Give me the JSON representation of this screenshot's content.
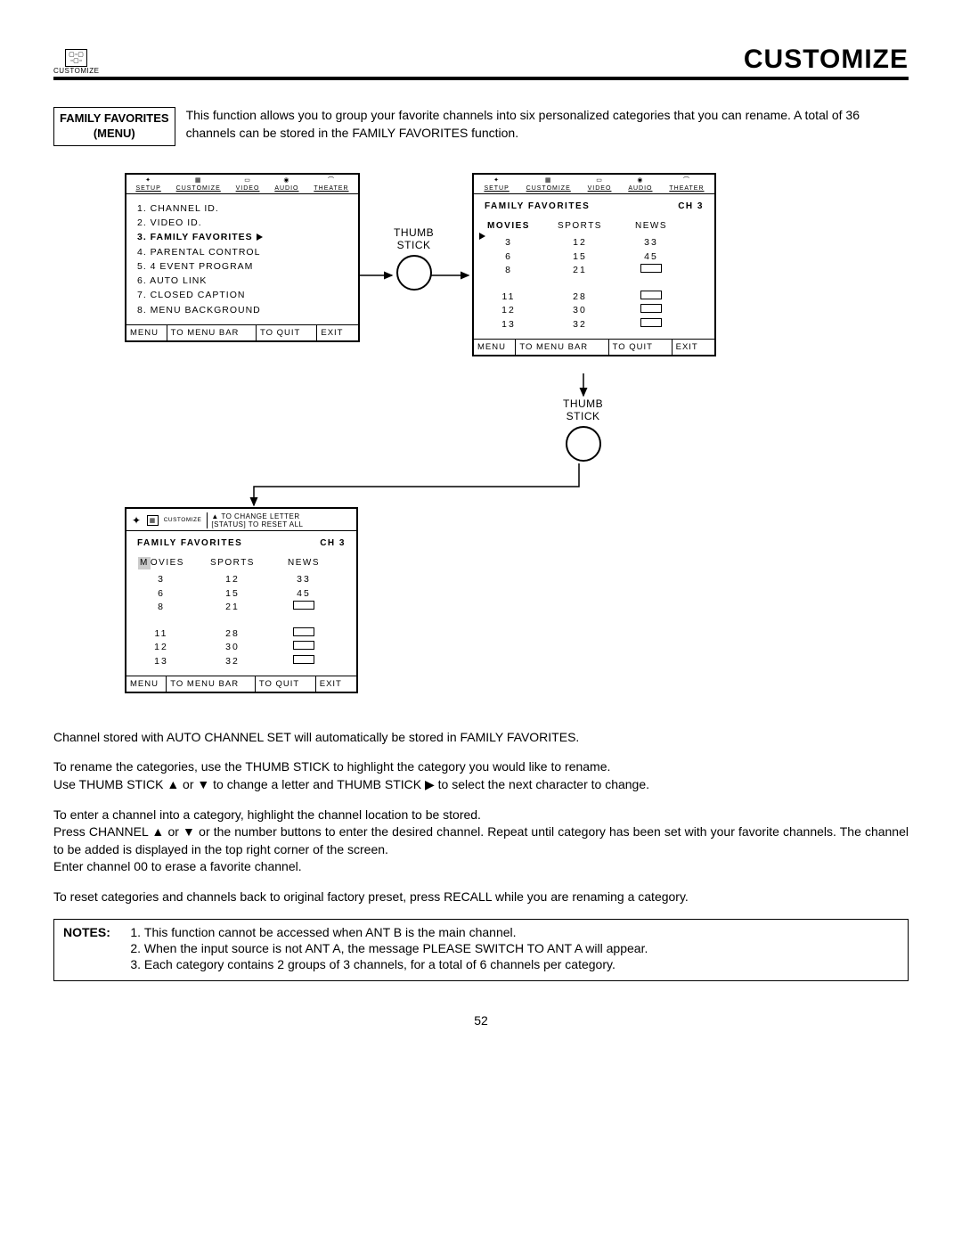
{
  "header": {
    "icon_label": "CUSTOMIZE",
    "title": "CUSTOMIZE"
  },
  "intro": {
    "box_line1": "FAMILY FAVORITES",
    "box_line2": "(MENU)",
    "text": "This function allows you to group your favorite channels into six personalized categories that you can rename. A total of 36 channels can be stored in the FAMILY FAVORITES function."
  },
  "tabs": [
    "SETUP",
    "CUSTOMIZE",
    "VIDEO",
    "AUDIO",
    "THEATER"
  ],
  "panel1": {
    "items": [
      "1. CHANNEL ID.",
      "2. VIDEO ID.",
      "3. FAMILY FAVORITES",
      "4. PARENTAL CONTROL",
      "5. 4 EVENT PROGRAM",
      "6. AUTO LINK",
      "7. CLOSED CAPTION",
      "8. MENU BACKGROUND"
    ]
  },
  "panel_footer": {
    "a": "MENU",
    "b": "TO MENU BAR",
    "c": "TO QUIT",
    "d": "EXIT"
  },
  "thumb_label": "THUMB\nSTICK",
  "ff": {
    "title": "FAMILY FAVORITES",
    "ch": "CH   3",
    "cats": [
      "MOVIES",
      "SPORTS",
      "NEWS"
    ],
    "col1": [
      "3",
      "6",
      "8",
      "",
      "11",
      "12",
      "13"
    ],
    "col2": [
      "12",
      "15",
      "21",
      "",
      "28",
      "30",
      "32"
    ],
    "col3": [
      "33",
      "45",
      "□",
      "",
      "□",
      "□",
      "□"
    ]
  },
  "panel3_head": {
    "l1": "▲ TO CHANGE LETTER",
    "l2": "[STATUS] TO RESET ALL"
  },
  "body": {
    "p1": "Channel stored with AUTO CHANNEL SET will automatically be stored in FAMILY FAVORITES.",
    "p2": "To rename the categories, use the THUMB STICK to highlight the category you would like to rename.",
    "p3": "Use THUMB STICK ▲ or ▼ to change a letter and THUMB STICK ▶ to select the next character to change.",
    "p4": "To enter a channel into a category, highlight the channel location to be stored.",
    "p5": "Press CHANNEL ▲ or ▼ or the number buttons to enter the desired channel.  Repeat until category has been set with your favorite channels.  The channel to be added is displayed in the top right corner of the screen.",
    "p6": "Enter channel 00 to erase a favorite channel.",
    "p7": "To reset categories and channels back to original factory preset, press RECALL while you are renaming a category."
  },
  "notes": {
    "label": "NOTES:",
    "items": [
      "This function cannot be accessed when ANT B is the main channel.",
      "When the input source is not ANT A, the message  PLEASE SWITCH TO ANT A  will appear.",
      "Each category contains 2 groups of 3 channels, for a total of 6 channels per category."
    ]
  },
  "page": "52"
}
